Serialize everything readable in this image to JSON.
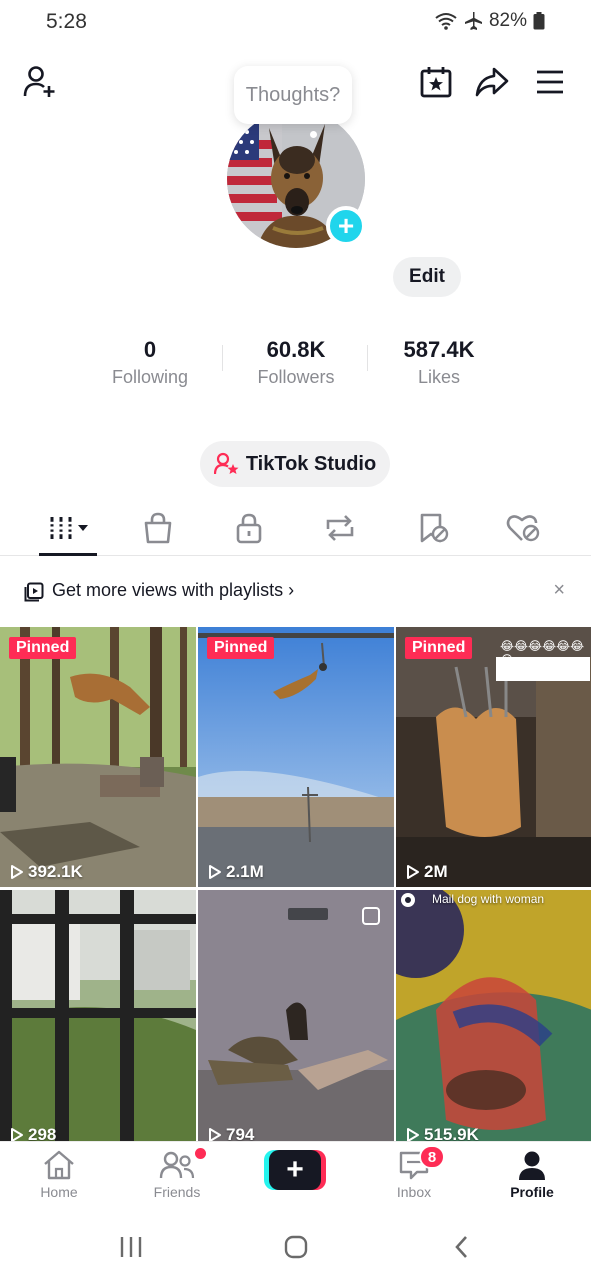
{
  "status_bar": {
    "time": "5:28",
    "battery": "82%"
  },
  "profile": {
    "thoughts_placeholder": "Thoughts?",
    "edit_label": "Edit",
    "stats": [
      {
        "value": "0",
        "label": "Following"
      },
      {
        "value": "60.8K",
        "label": "Followers"
      },
      {
        "value": "587.4K",
        "label": "Likes"
      }
    ],
    "studio_label": "TikTok Studio"
  },
  "tabs": [
    {
      "icon": "videos-grid-icon",
      "active": true
    },
    {
      "icon": "shop-bag-icon"
    },
    {
      "icon": "lock-icon"
    },
    {
      "icon": "repost-icon"
    },
    {
      "icon": "favorites-hidden-icon"
    },
    {
      "icon": "liked-hidden-icon"
    }
  ],
  "playlist_banner": {
    "text": "Get more views with playlists",
    "chevron": "›",
    "close": "×"
  },
  "videos": [
    {
      "pinned_label": "Pinned",
      "views": "392.1K"
    },
    {
      "pinned_label": "Pinned",
      "views": "2.1M"
    },
    {
      "pinned_label": "Pinned",
      "views": "2M",
      "overlay": "😂😂😂😂😂😂😂"
    },
    {
      "views": "298"
    },
    {
      "views": "794"
    },
    {
      "views": "515.9K",
      "caption": "Mail dog with woman"
    }
  ],
  "bottom_nav": {
    "home": "Home",
    "friends": "Friends",
    "inbox": "Inbox",
    "inbox_badge": "8",
    "profile": "Profile"
  },
  "colors": {
    "accent_red": "#fe2c55",
    "accent_cyan": "#25f4ee",
    "text": "#161823",
    "muted": "#8a8b91"
  }
}
